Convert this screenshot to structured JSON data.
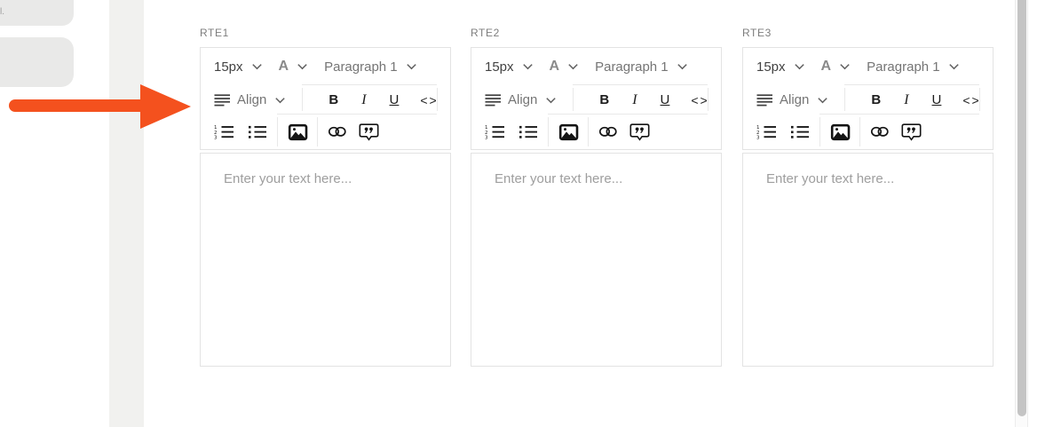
{
  "editors": [
    {
      "label": "RTE1"
    },
    {
      "label": "RTE2"
    },
    {
      "label": "RTE3"
    }
  ],
  "toolbar": {
    "font_size": "15px",
    "font_color": "A",
    "paragraph_format": "Paragraph 1",
    "align": "Align",
    "bold": "B",
    "italic": "I",
    "underline": "U",
    "code": "<>"
  },
  "editor": {
    "placeholder": "Enter your text here..."
  },
  "decorations": {
    "left_edge_text_fragment": "l."
  },
  "colors": {
    "arrow": "#f4511e",
    "box_border": "#e3e3e3",
    "separator": "#e8e8e8",
    "placeholder_text": "#9e9e9e",
    "label_text": "#7d7d7d",
    "strip": "#f1f1ef",
    "left_pills": "#e9e9e8",
    "scrollbar_thumb": "#c4c4c4"
  }
}
